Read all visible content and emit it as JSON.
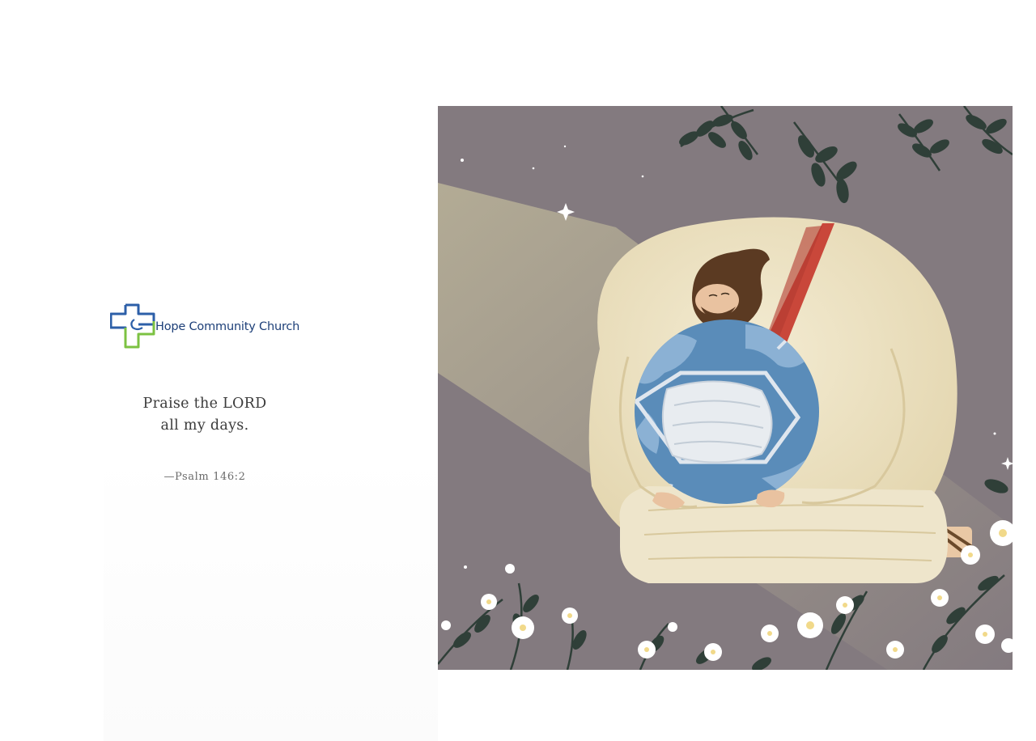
{
  "church": {
    "name": "Hope Community Church",
    "logo_colors": {
      "blue": "#2c5fa8",
      "green": "#7cc242"
    }
  },
  "verse": {
    "line1": "Praise the LORD",
    "line2": "all my days.",
    "citation": "—Psalm 146:2"
  },
  "artwork": {
    "icon": "illustration-figure-hugging-masked-earth",
    "palette": {
      "background": "#837a7f",
      "robe": "#ede3c6",
      "sash": "#c9473a",
      "earth_ocean": "#5a8cb9",
      "mask": "#e8ecf0",
      "leaves": "#2f3f38",
      "flowers": "#ffffff"
    }
  }
}
